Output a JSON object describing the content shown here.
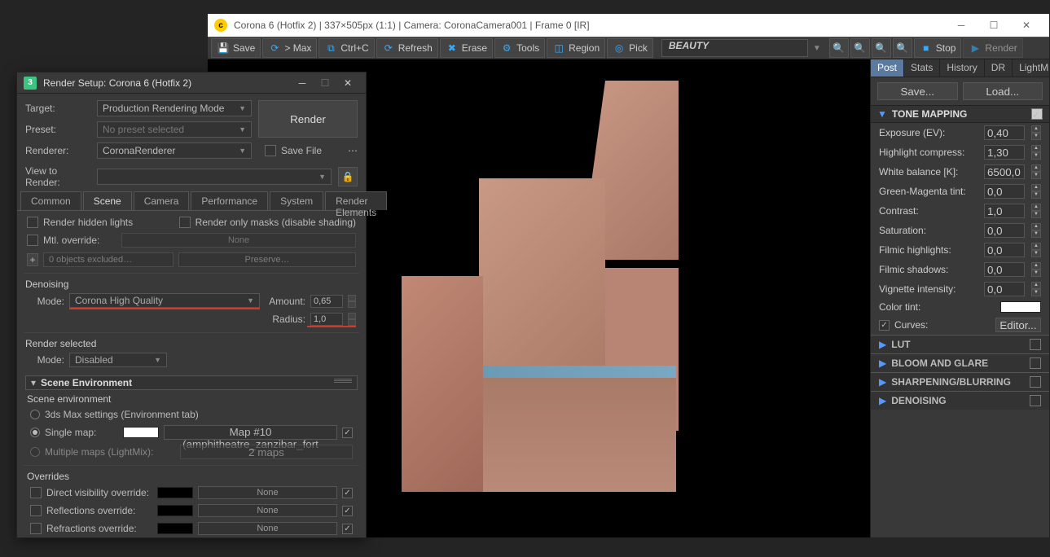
{
  "vfb": {
    "title": "Corona 6 (Hotfix 2) | 337×505px (1:1) | Camera: CoronaCamera001 | Frame 0 [IR]",
    "toolbar": {
      "save": "Save",
      "max": "> Max",
      "ctrlc": "Ctrl+C",
      "refresh": "Refresh",
      "erase": "Erase",
      "tools": "Tools",
      "region": "Region",
      "pick": "Pick",
      "pass": "BEAUTY",
      "stop": "Stop",
      "render": "Render"
    },
    "tabs": {
      "post": "Post",
      "stats": "Stats",
      "history": "History",
      "dr": "DR",
      "lightmix": "LightMix"
    },
    "buttons": {
      "save": "Save...",
      "load": "Load..."
    },
    "tone": {
      "header": "TONE MAPPING",
      "exposure_l": "Exposure (EV):",
      "exposure_v": "0,40",
      "highlight_l": "Highlight compress:",
      "highlight_v": "1,30",
      "wb_l": "White balance [K]:",
      "wb_v": "6500,0",
      "gm_l": "Green-Magenta tint:",
      "gm_v": "0,0",
      "contrast_l": "Contrast:",
      "contrast_v": "1,0",
      "sat_l": "Saturation:",
      "sat_v": "0,0",
      "fh_l": "Filmic highlights:",
      "fh_v": "0,0",
      "fs_l": "Filmic shadows:",
      "fs_v": "0,0",
      "vig_l": "Vignette intensity:",
      "vig_v": "0,0",
      "tint_l": "Color tint:",
      "curves_l": "Curves:",
      "curves_btn": "Editor..."
    },
    "sections": {
      "lut": "LUT",
      "bloom": "BLOOM AND GLARE",
      "sharp": "SHARPENING/BLURRING",
      "denoise": "DENOISING"
    }
  },
  "rsd": {
    "title": "Render Setup: Corona 6 (Hotfix 2)",
    "target_l": "Target:",
    "target_v": "Production Rendering Mode",
    "preset_l": "Preset:",
    "preset_v": "No preset selected",
    "renderer_l": "Renderer:",
    "renderer_v": "CoronaRenderer",
    "render_btn": "Render",
    "savefile": "Save File",
    "view_l": "View to Render:",
    "tabs": {
      "common": "Common",
      "scene": "Scene",
      "camera": "Camera",
      "perf": "Performance",
      "system": "System",
      "elems": "Render Elements"
    },
    "scene": {
      "hidden": "Render hidden lights",
      "masks": "Render only masks (disable shading)",
      "mtlov": "Mtl. override:",
      "none": "None",
      "excl_btn": "0 objects excluded…",
      "preserve": "Preserve…",
      "denoising_h": "Denoising",
      "mode_l": "Mode:",
      "mode_v": "Corona High Quality",
      "amount_l": "Amount:",
      "amount_v": "0,65",
      "radius_l": "Radius:",
      "radius_v": "1,0",
      "rendersel_h": "Render selected",
      "rendersel_mode_l": "Mode:",
      "rendersel_mode_v": "Disabled"
    },
    "env": {
      "rollout": "Scene Environment",
      "head": "Scene environment",
      "opt_max": "3ds Max settings (Environment tab)",
      "opt_single": "Single map:",
      "single_map": "Map #10 (amphitheatre_zanzibar_fort",
      "opt_multi": "Multiple maps (LightMix):",
      "multi_btn": "2 maps",
      "ov_head": "Overrides",
      "ov_direct": "Direct visibility override:",
      "ov_refl": "Reflections override:",
      "ov_refr": "Refractions override:",
      "none": "None"
    }
  }
}
